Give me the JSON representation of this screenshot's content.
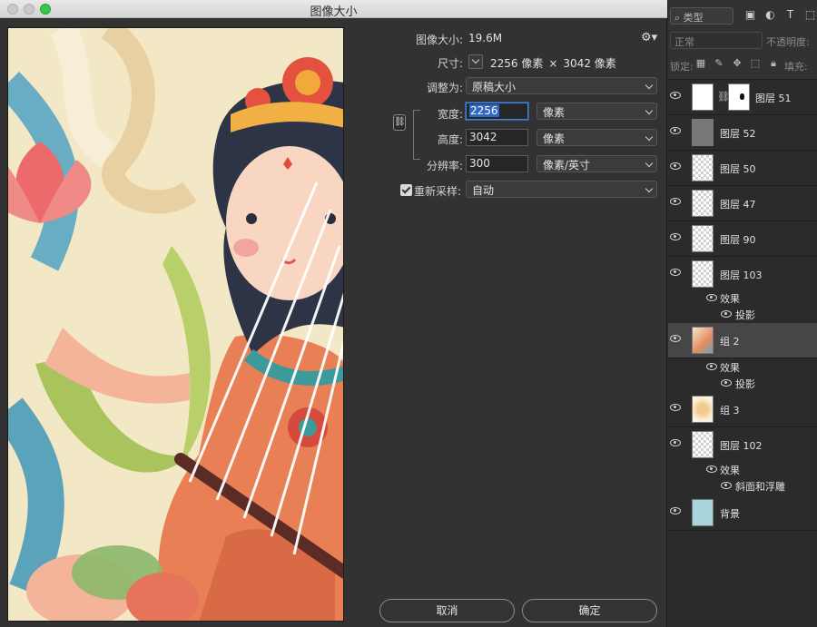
{
  "window": {
    "title": "图像大小"
  },
  "image_size": {
    "label": "图像大小:",
    "value": "19.6M"
  },
  "dimensions": {
    "label": "尺寸:",
    "width": "2256 像素",
    "times": "×",
    "height": "3042 像素"
  },
  "fit_to": {
    "label": "调整为:",
    "value": "原稿大小"
  },
  "width": {
    "label": "宽度:",
    "value": "2256",
    "unit": "像素"
  },
  "height": {
    "label": "高度:",
    "value": "3042",
    "unit": "像素"
  },
  "resolution": {
    "label": "分辨率:",
    "value": "300",
    "unit": "像素/英寸"
  },
  "resample": {
    "label": "重新采样:",
    "value": "自动",
    "checked": true
  },
  "buttons": {
    "cancel": "取消",
    "ok": "确定"
  },
  "icons": {
    "gear": "gear-icon",
    "link": "chain-link-icon"
  },
  "layers_panel": {
    "kind_filter": "类型",
    "blend_mode": "正常",
    "opacity_label": "不透明度:",
    "lock_label": "锁定:",
    "fill_label": "填充:",
    "layers": [
      {
        "name": "图层 51"
      },
      {
        "name": "图层 52"
      },
      {
        "name": "图层 50"
      },
      {
        "name": "图层 47"
      },
      {
        "name": "图层 90"
      },
      {
        "name": "图层 103"
      },
      {
        "name": "组 2"
      },
      {
        "name": "组 3"
      },
      {
        "name": "图层 102"
      },
      {
        "name": "背景"
      }
    ],
    "effects": {
      "label": "效果",
      "drop_shadow": "投影",
      "bevel": "斜面和浮雕"
    }
  }
}
